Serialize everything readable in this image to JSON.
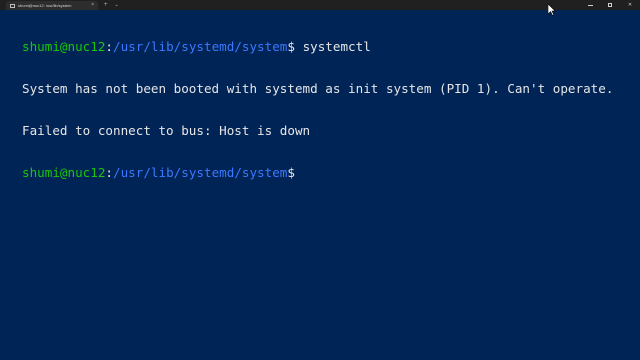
{
  "tab": {
    "title": "shumi@nuc12: /usr/lib/system",
    "close_glyph": "×"
  },
  "tabbar": {
    "new_tab_glyph": "+",
    "dropdown_glyph": "⌄"
  },
  "window_controls": {
    "close_glyph": "✕"
  },
  "terminal": {
    "lines": [
      {
        "user_host": "shumi@nuc12",
        "sep": ":",
        "path": "/usr/lib/systemd/system",
        "prompt": "$ ",
        "command": "systemctl"
      },
      {
        "text": "System has not been booted with systemd as init system (PID 1). Can't operate."
      },
      {
        "text": "Failed to connect to bus: Host is down"
      },
      {
        "user_host": "shumi@nuc12",
        "sep": ":",
        "path": "/usr/lib/systemd/system",
        "prompt": "$ ",
        "command": ""
      }
    ]
  },
  "colors": {
    "background": "#012456",
    "user_host": "#16c60c",
    "path": "#3b78ff",
    "text": "#e6e6e6",
    "titlebar": "#202020"
  },
  "icons": {
    "tab_icon": "terminal-icon",
    "pointer": "mouse-pointer-icon"
  }
}
